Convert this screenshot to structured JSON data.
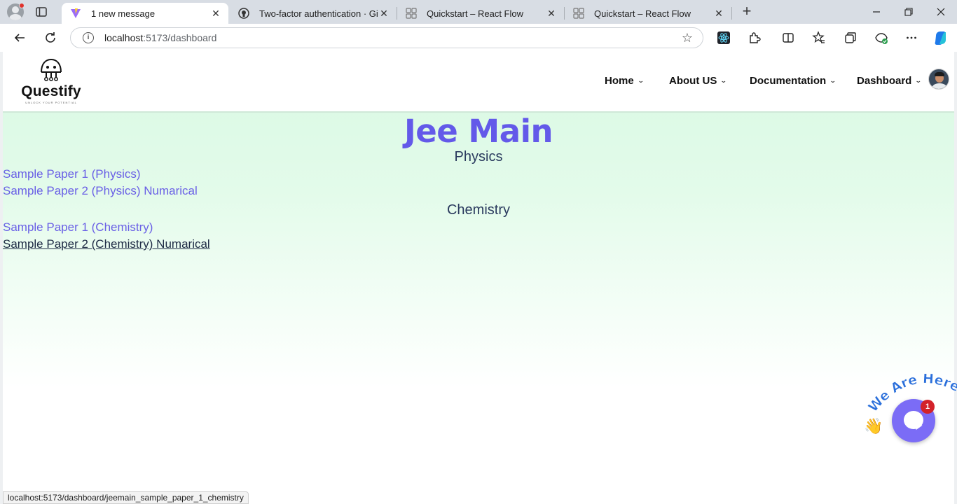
{
  "browser": {
    "tabs": [
      {
        "title": "1 new message",
        "favicon": "vite-icon",
        "active": true
      },
      {
        "title": "Two-factor authentication · GitHub",
        "favicon": "github-icon",
        "active": false
      },
      {
        "title": "Quickstart – React Flow",
        "favicon": "react-flow-icon",
        "active": false
      },
      {
        "title": "Quickstart – React Flow",
        "favicon": "react-flow-icon",
        "active": false
      }
    ],
    "url_host": "localhost",
    "url_path": ":5173/dashboard",
    "status_url": "localhost:5173/dashboard/jeemain_sample_paper_1_chemistry"
  },
  "site": {
    "logo_name": "Questify",
    "logo_tagline": "UNLOCK YOUR POTENTIAL",
    "nav": [
      {
        "label": "Home"
      },
      {
        "label": "About US"
      },
      {
        "label": "Documentation"
      },
      {
        "label": "Dashboard"
      }
    ]
  },
  "main": {
    "title": "Jee Main",
    "sections": [
      {
        "heading": "Physics",
        "links": [
          "Sample Paper 1 (Physics)",
          "Sample Paper 2 (Physics) Numarical"
        ]
      },
      {
        "heading": "Chemistry",
        "links": [
          "Sample Paper 1 (Chemistry)",
          "Sample Paper 2 (Chemistry) Numarical"
        ]
      }
    ]
  },
  "chat": {
    "banner": "We Are Here!",
    "badge_count": "1"
  },
  "colors": {
    "accent": "#6359e9",
    "link": "#6a60e6",
    "chat": "#7b6cf6",
    "badge": "#d3222a"
  }
}
